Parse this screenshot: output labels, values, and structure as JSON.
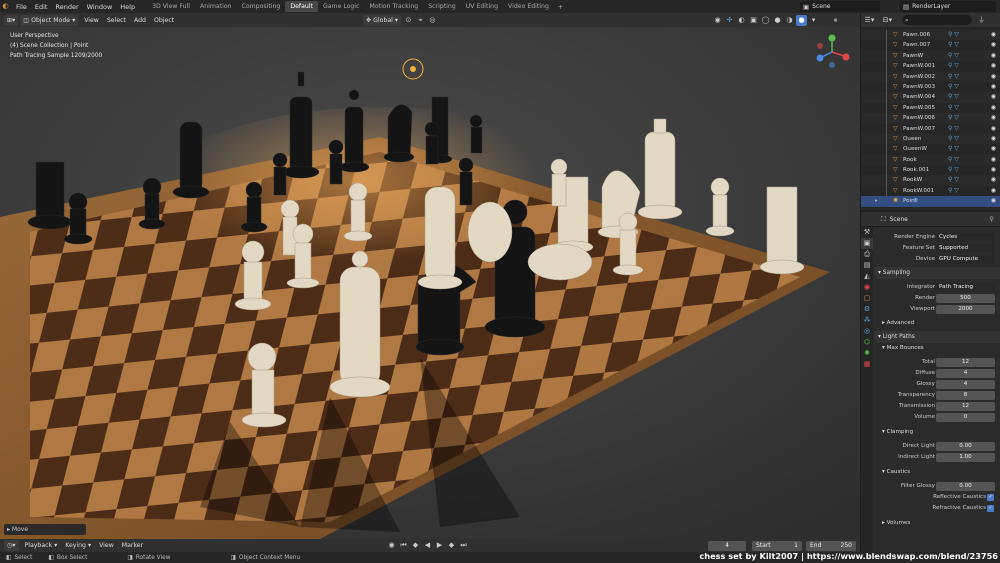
{
  "menu": [
    "File",
    "Edit",
    "Render",
    "Window",
    "Help"
  ],
  "workspace_tabs": [
    "3D View Full",
    "Animation",
    "Compositing",
    "Default",
    "Game Logic",
    "Motion Tracking",
    "Scripting",
    "UV Editing",
    "Video Editing"
  ],
  "active_tab": "Default",
  "add_tab": "+",
  "scene_name": "Scene",
  "render_layer": "RenderLayer",
  "viewport": {
    "mode": "Object Mode",
    "menus": [
      "View",
      "Select",
      "Add",
      "Object"
    ],
    "orientation": "Global",
    "overlay_lines": [
      "User Perspective",
      "(4) Scene Collection | Point",
      "Path Tracing Sample 1209/2000"
    ],
    "move_panel": "Move"
  },
  "outliner": {
    "items": [
      "Pawn.006",
      "Pawn.007",
      "PawnW",
      "PawnW.001",
      "PawnW.002",
      "PawnW.003",
      "PawnW.004",
      "PawnW.005",
      "PawnW.006",
      "PawnW.007",
      "Queen",
      "QueenW",
      "Rook",
      "Rook.001",
      "RookW",
      "RookW.001",
      "Point"
    ],
    "selected": "Point"
  },
  "properties": {
    "header": "Scene",
    "render_engine_label": "Render Engine",
    "render_engine": "Cycles",
    "feature_set_label": "Feature Set",
    "feature_set": "Supported",
    "device_label": "Device",
    "device": "GPU Compute",
    "sampling": {
      "title": "Sampling",
      "integrator_label": "Integrator",
      "integrator": "Path Tracing",
      "render_label": "Render",
      "render": "500",
      "viewport_label": "Viewport",
      "viewport": "2000"
    },
    "advanced": "Advanced",
    "light_paths": {
      "title": "Light Paths",
      "max_bounces": "Max Bounces",
      "total_label": "Total",
      "total": "12",
      "diffuse_label": "Diffuse",
      "diffuse": "4",
      "glossy_label": "Glossy",
      "glossy": "4",
      "transparency_label": "Transparency",
      "transparency": "8",
      "transmission_label": "Transmission",
      "transmission": "12",
      "volume_label": "Volume",
      "volume": "0"
    },
    "clamping": {
      "title": "Clamping",
      "direct_label": "Direct Light",
      "direct": "0.00",
      "indirect_label": "Indirect Light",
      "indirect": "1.00"
    },
    "caustics": {
      "title": "Caustics",
      "filter_label": "Filter Glossy",
      "filter": "0.00",
      "reflective": "Reflective Caustics",
      "refractive": "Refractive Caustics"
    },
    "volumes": "Volumes"
  },
  "timeline": {
    "menus": [
      "Playback",
      "Keying",
      "View",
      "Marker"
    ],
    "current_frame": "4",
    "start_label": "Start",
    "start": "1",
    "end_label": "End",
    "end": "250"
  },
  "status": {
    "select": "Select",
    "box_select": "Box Select",
    "rotate_view": "Rotate View",
    "context_menu": "Object Context Menu"
  },
  "credit": "chess set by Kilt2007 | https://www.blendswap.com/blend/23756",
  "colors": {
    "accent": "#4a7cc7",
    "selected": "#334d80",
    "active_tab": "#474747",
    "icon_orange": "#e4923a"
  }
}
